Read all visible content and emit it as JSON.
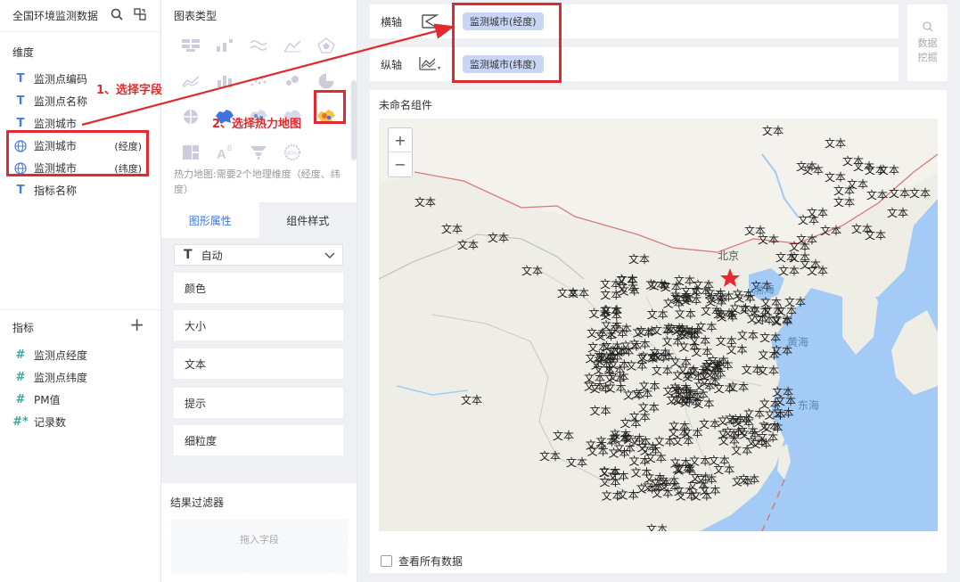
{
  "dataset": {
    "name": "全国环境监测数据"
  },
  "dimensions": {
    "title": "维度",
    "items": [
      {
        "type": "T",
        "label": "监测点编码"
      },
      {
        "type": "T",
        "label": "监测点名称"
      },
      {
        "type": "T",
        "label": "监测城市"
      },
      {
        "type": "geo",
        "label": "监测城市",
        "tag": "(经度)"
      },
      {
        "type": "geo",
        "label": "监测城市",
        "tag": "(纬度)"
      },
      {
        "type": "T",
        "label": "指标名称"
      }
    ]
  },
  "measures": {
    "title": "指标",
    "add": "+",
    "items": [
      {
        "type": "#",
        "label": "监测点经度"
      },
      {
        "type": "#",
        "label": "监测点纬度"
      },
      {
        "type": "#",
        "label": "PM值"
      },
      {
        "type": "#*",
        "label": "记录数"
      }
    ]
  },
  "chart_panel": {
    "title": "图表类型",
    "hint": "热力地图:需要2个地理维度（经度、纬度）",
    "tabs": [
      "图形属性",
      "组件样式"
    ],
    "auto_select": "自动",
    "props": [
      "颜色",
      "大小",
      "文本",
      "提示",
      "细粒度"
    ],
    "filter_title": "结果过滤器",
    "filter_drop": "拖入字段"
  },
  "axes": {
    "x_label": "横轴",
    "y_label": "纵轴",
    "x_field": "监测城市(经度)",
    "y_field": "监测城市(纬度)"
  },
  "mining": {
    "line1": "数据",
    "line2": "挖掘"
  },
  "canvas": {
    "title": "未命名组件",
    "view_all": "查看所有数据",
    "zoom_in": "+",
    "zoom_out": "−"
  },
  "map": {
    "city_label": "北京",
    "sea_bohai": "渤海",
    "sea_yellow": "黄海",
    "sea_east": "东海",
    "marker_text": "文本"
  },
  "annotations": {
    "step1": "1、选择字段",
    "step2": "2、选择热力地图"
  },
  "colors": {
    "accent": "#3f73e0",
    "annotation": "#e02a2f",
    "pill": "#c8d5f5",
    "water": "#a3cbf5"
  }
}
